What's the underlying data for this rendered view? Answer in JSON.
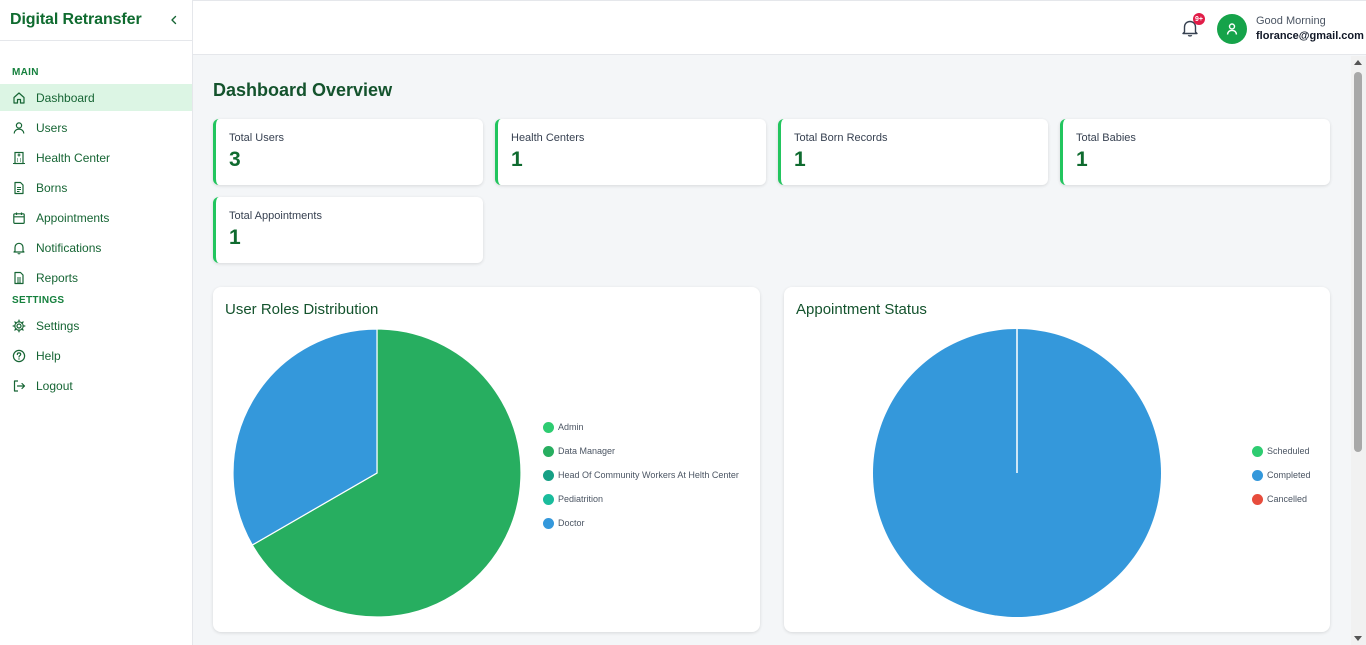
{
  "app": {
    "title": "Digital Retransfer"
  },
  "sidebar": {
    "main_label": "MAIN",
    "settings_label": "SETTINGS",
    "main_items": [
      {
        "label": "Dashboard",
        "icon": "home-icon",
        "active": true
      },
      {
        "label": "Users",
        "icon": "user-icon"
      },
      {
        "label": "Health Center",
        "icon": "building-icon"
      },
      {
        "label": "Borns",
        "icon": "file-icon"
      },
      {
        "label": "Appointments",
        "icon": "calendar-icon"
      },
      {
        "label": "Notifications",
        "icon": "bell-icon"
      },
      {
        "label": "Reports",
        "icon": "report-icon"
      }
    ],
    "settings_items": [
      {
        "label": "Settings",
        "icon": "gear-icon"
      },
      {
        "label": "Help",
        "icon": "help-icon"
      },
      {
        "label": "Logout",
        "icon": "logout-icon"
      }
    ]
  },
  "header": {
    "notification_badge": "9+",
    "greeting": "Good Morning",
    "email": "florance@gmail.com"
  },
  "page": {
    "title": "Dashboard Overview"
  },
  "stats": [
    {
      "label": "Total Users",
      "value": "3"
    },
    {
      "label": "Health Centers",
      "value": "1"
    },
    {
      "label": "Total Born Records",
      "value": "1"
    },
    {
      "label": "Total Babies",
      "value": "1"
    },
    {
      "label": "Total Appointments",
      "value": "1"
    }
  ],
  "colors": {
    "brand": "#0f6b2f",
    "accent": "#22c55e",
    "pie_green": "#27ae60",
    "pie_blue": "#3498db"
  },
  "chart_data": [
    {
      "type": "pie",
      "title": "User Roles Distribution",
      "categories": [
        "Admin",
        "Data Manager",
        "Head Of Community Workers At Helth Center",
        "Pediatrition",
        "Doctor"
      ],
      "values": [
        0,
        2,
        0,
        0,
        1
      ],
      "colors": [
        "#2ecc71",
        "#27ae60",
        "#16a085",
        "#1abc9c",
        "#3498db"
      ],
      "legend": "right"
    },
    {
      "type": "pie",
      "title": "Appointment Status",
      "categories": [
        "Scheduled",
        "Completed",
        "Cancelled"
      ],
      "values": [
        0,
        1,
        0
      ],
      "colors": [
        "#2ecc71",
        "#3498db",
        "#e74c3c"
      ],
      "legend": "right"
    }
  ]
}
